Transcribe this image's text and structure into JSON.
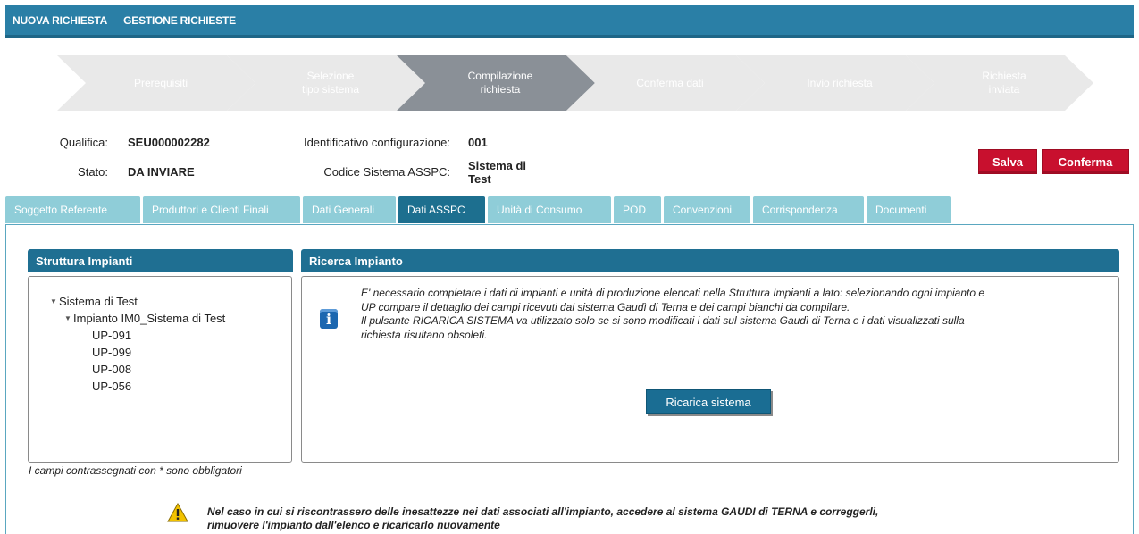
{
  "topnav": {
    "items": [
      "NUOVA RICHIESTA",
      "GESTIONE RICHIESTE"
    ]
  },
  "steps": [
    {
      "label": "Prerequisiti"
    },
    {
      "label": "Selezione\ntipo sistema"
    },
    {
      "label": "Compilazione\nrichiesta",
      "active": true
    },
    {
      "label": "Conferma dati"
    },
    {
      "label": "Invio richiesta"
    },
    {
      "label": "Richiesta\ninviata"
    }
  ],
  "info": {
    "qualifica_label": "Qualifica:",
    "qualifica_value": "SEU000002282",
    "stato_label": "Stato:",
    "stato_value": "DA INVIARE",
    "id_config_label": "Identificativo configurazione:",
    "id_config_value": "001",
    "codice_label": "Codice Sistema ASSPC:",
    "codice_value": "Sistema di\nTest"
  },
  "actions": {
    "salva": "Salva",
    "conferma": "Conferma"
  },
  "tabs": [
    {
      "label": "Soggetto Referente"
    },
    {
      "label": "Produttori e Clienti Finali"
    },
    {
      "label": "Dati Generali"
    },
    {
      "label": "Dati ASSPC",
      "active": true
    },
    {
      "label": "Unità di Consumo"
    },
    {
      "label": "POD"
    },
    {
      "label": "Convenzioni"
    },
    {
      "label": "Corrispondenza"
    },
    {
      "label": "Documenti"
    }
  ],
  "struttura": {
    "title": "Struttura Impianti",
    "root": "Sistema di Test",
    "impianto": "Impianto IM0_Sistema di Test",
    "up": [
      "UP-091",
      "UP-099",
      "UP-008",
      "UP-056"
    ]
  },
  "ricerca": {
    "title": "Ricerca Impianto",
    "text_line1": "E' necessario completare i dati di impianti e unità di produzione elencati nella Struttura Impianti a lato: selezionando ogni impianto e",
    "text_line2": "UP compare il dettaglio dei campi ricevuti dal sistema Gaudì di Terna e dei campi bianchi da compilare.",
    "text_line3": "Il pulsante RICARICA SISTEMA va utilizzato solo se si sono modificati i dati sul sistema Gaudì di Terna e i dati visualizzati sulla",
    "text_line4": "richiesta risultano obsoleti.",
    "button": "Ricarica sistema"
  },
  "note": "I campi contrassegnati con * sono obbligatori",
  "warning": {
    "line1": "Nel caso in cui si riscontrassero delle inesattezze nei dati associati all'impianto, accedere al sistema GAUDI di TERNA e correggerli,",
    "line2": "rimuovere l'impianto dall'elenco e ricaricarlo nuovamente"
  },
  "colors": {
    "primary": "#1f6f92",
    "tab_inactive": "#8fcdd8",
    "step_inactive": "#e9e9e9",
    "step_active": "#8a9097",
    "danger": "#c8102e"
  }
}
